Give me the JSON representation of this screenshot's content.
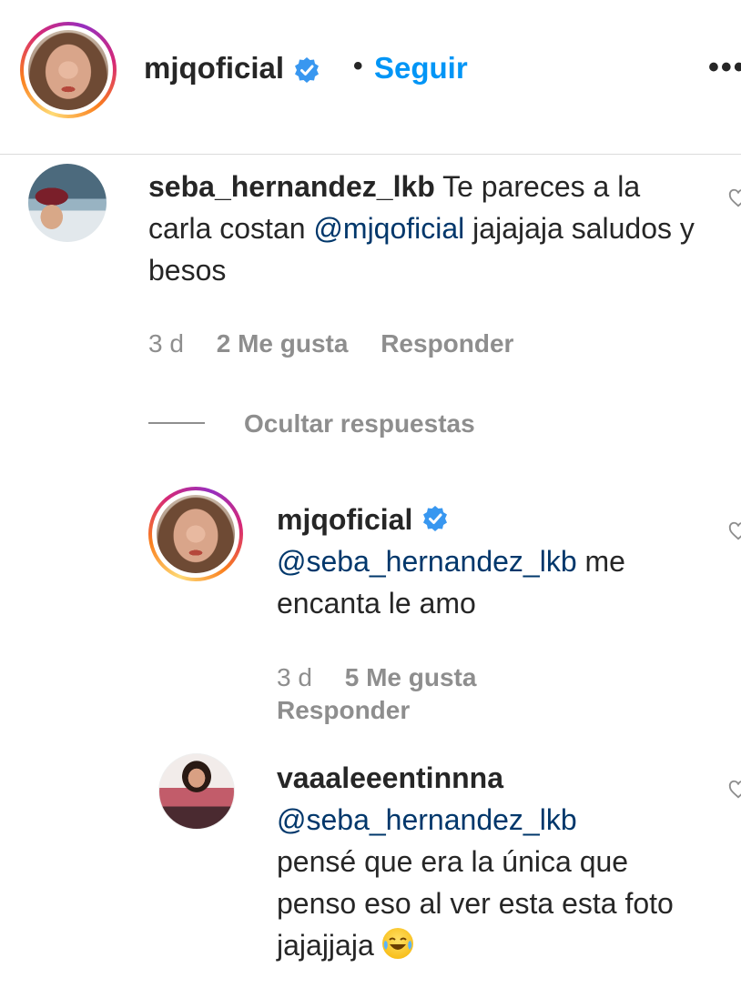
{
  "header": {
    "username": "mjqoficial",
    "separator": "•",
    "follow_label": "Seguir",
    "more_label": "•••"
  },
  "comment": {
    "username": "seba_hernandez_lkb",
    "text_before": " Te pareces a la carla costan ",
    "mention": "@mjqoficial",
    "text_after": " jajajaja saludos y besos",
    "time": "3 d",
    "likes": "2 Me gusta",
    "reply_label": "Responder"
  },
  "replies_toggle": {
    "label": "Ocultar respuestas"
  },
  "reply1": {
    "username": "mjqoficial",
    "mention": "@seba_hernandez_lkb",
    "text_after": " me encanta le amo",
    "time": "3 d",
    "likes": "5 Me gusta",
    "reply_label": "Responder"
  },
  "reply2": {
    "username": "vaaaleeentinnna",
    "mention": "@seba_hernandez_lkb",
    "text": "pensé que era la única que penso eso al ver esta esta foto jajajjaja",
    "emoji": "face-with-tears-of-joy-icon"
  },
  "colors": {
    "link_blue": "#0095f6",
    "mention_blue": "#00376b",
    "muted_gray": "#8e8e8e",
    "verified_blue": "#3897f0"
  }
}
